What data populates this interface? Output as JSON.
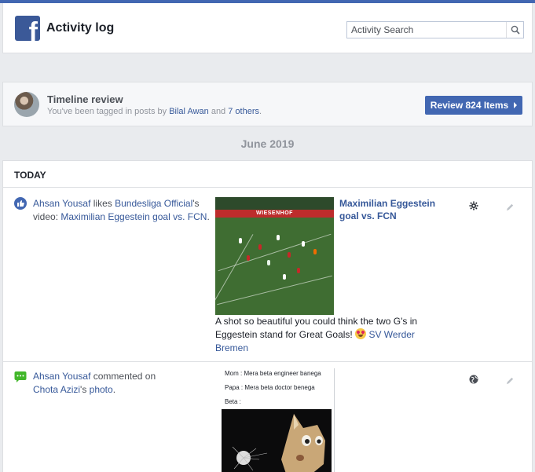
{
  "header": {
    "logo_glyph": "f",
    "title": "Activity log",
    "search_placeholder": "Activity Search",
    "search_icon": "magnifier-icon"
  },
  "review": {
    "title": "Timeline review",
    "sub_prefix": "You've been tagged in posts by ",
    "sub_name": "Bilal Awan",
    "sub_mid": " and ",
    "sub_others": "7 others",
    "sub_end": ".",
    "button_label": "Review 824 Items"
  },
  "month_label": "June 2019",
  "section_label": "TODAY",
  "entries": [
    {
      "icon": "like-icon",
      "actor": "Ahsan Yousaf",
      "verb": " likes ",
      "target": "Bundesliga Official",
      "tail": "'s video: ",
      "object": "Maximilian Eggestein goal vs. FCN",
      "end": ".",
      "post_title": "Maximilian Eggestein goal vs. FCN",
      "caption": "A shot so beautiful you could think the two G's in Eggestein stand for Great Goals!",
      "caption_link": "SV Werder Bremen",
      "privacy_icon": "gear-privacy-icon",
      "banner_text": "WIESENHOF"
    },
    {
      "icon": "comment-icon",
      "actor": "Ahsan Yousaf",
      "verb": " commented on ",
      "target": "Chota Azizi",
      "tail": "'s ",
      "object": "photo",
      "end": ".",
      "meme_lines": [
        "Mom : Mera beta engineer banega",
        "Papa : Mera beta doctor benega",
        "Beta :"
      ],
      "privacy_icon": "globe-icon"
    }
  ],
  "colors": {
    "brand": "#3b5998",
    "accent": "#4267b2",
    "link": "#365899",
    "muted": "#90949c"
  }
}
